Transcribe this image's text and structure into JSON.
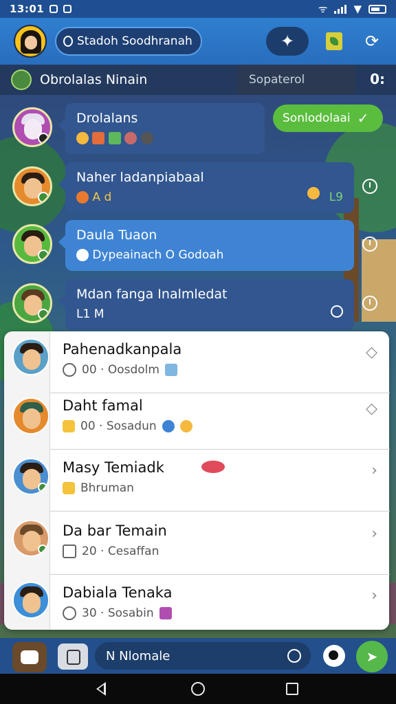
{
  "status_bar": {
    "time": "13:01"
  },
  "header": {
    "search_text": "Stadoh Soodhranah"
  },
  "subheader": {
    "title": "Obrolalas Ninain",
    "field_text": "Sopaterol",
    "stat": "0:"
  },
  "chats": [
    {
      "name": "Drolalans",
      "sub": ""
    },
    {
      "name": "Naher ladanpiabaal",
      "sub": "A d",
      "extra": "L9"
    },
    {
      "name": "Daula Tuaon",
      "sub": "Dypeainach O Godoah"
    },
    {
      "name": "Mdan fanga Inalmledat",
      "sub": "L1 M"
    }
  ],
  "green_tag": {
    "label": "Sonlodolaai"
  },
  "list": [
    {
      "name": "Pahenadkanpala",
      "meta": "00 · Oosdolm"
    },
    {
      "name": "Daht famal",
      "meta": "00 · Sosadun"
    },
    {
      "name": "Masy Temiadk",
      "meta": "Bhruman"
    },
    {
      "name": "Da bar Temain",
      "meta": "20 · Cesaffan"
    },
    {
      "name": "Dabiala Tenaka",
      "meta": "30 · Sosabin"
    }
  ],
  "composer": {
    "placeholder": "N Nlomale"
  },
  "colors": {
    "header_blue": "#2f7fd0",
    "green_accent": "#5bbd3e",
    "bubble_blue": "#3f84d4",
    "bubble_navy": "#32568f"
  }
}
